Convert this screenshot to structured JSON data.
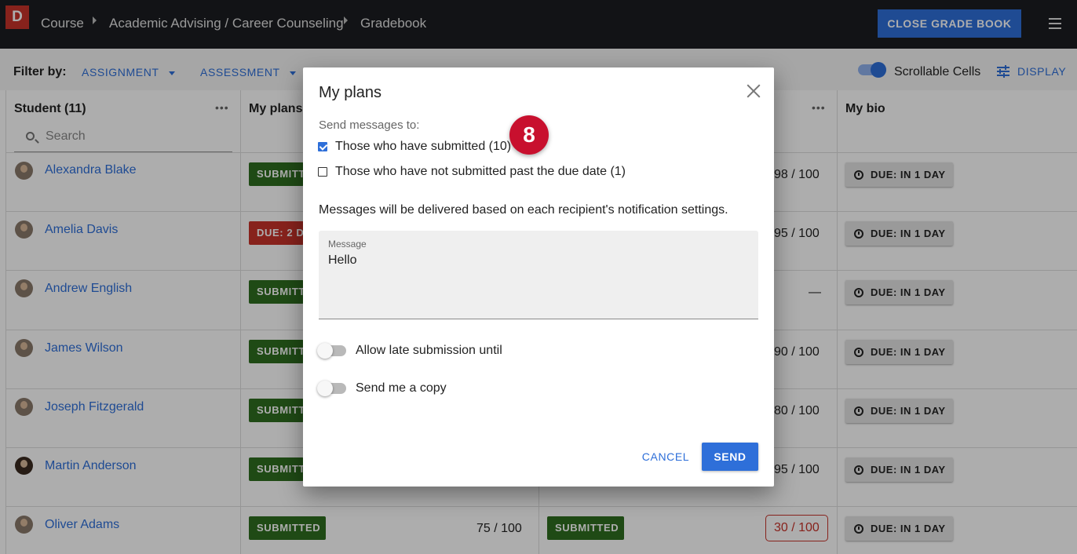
{
  "app": {
    "logo_letter": "D"
  },
  "breadcrumb": [
    "Course",
    "Academic Advising / Career Counseling",
    "Gradebook"
  ],
  "header": {
    "close_label": "CLOSE GRADE BOOK",
    "menu_icon": "hamburger-menu-icon"
  },
  "filter": {
    "label": "Filter by:",
    "assignment": "ASSIGNMENT",
    "assessment": "ASSESSMENT",
    "scrollable_label": "Scrollable Cells",
    "scrollable_on": true,
    "display_label": "DISPLAY"
  },
  "grid": {
    "student_header": "Student (11)",
    "col_plans": "My plans",
    "col_bio": "My bio",
    "search_placeholder": "Search",
    "rows": [
      {
        "name": "Alexandra Blake",
        "plans_badge": "SUBMITTED",
        "plans_status": "submitted",
        "mid_score": "98 / 100",
        "bio": "DUE: IN 1 DAY"
      },
      {
        "name": "Amelia Davis",
        "plans_badge": "DUE: 2 DAYS AGO",
        "plans_status": "late",
        "mid_score": "95 / 100",
        "bio": "DUE: IN 1 DAY"
      },
      {
        "name": "Andrew English",
        "plans_badge": "SUBMITTED",
        "plans_status": "submitted",
        "mid_score": "—",
        "bio": "DUE: IN 1 DAY"
      },
      {
        "name": "James Wilson",
        "plans_badge": "SUBMITTED",
        "plans_status": "submitted",
        "mid_score": "90 / 100",
        "bio": "DUE: IN 1 DAY"
      },
      {
        "name": "Joseph Fitzgerald",
        "plans_badge": "SUBMITTED",
        "plans_status": "submitted",
        "mid_score": "80 / 100",
        "bio": "DUE: IN 1 DAY"
      },
      {
        "name": "Martin Anderson",
        "plans_badge": "SUBMITTED",
        "plans_status": "submitted",
        "mid_score": "95 / 100",
        "bio": "DUE: IN 1 DAY"
      },
      {
        "name": "Oliver Adams",
        "plans_badge": "SUBMITTED",
        "plans_status": "submitted",
        "plans_score": "75 / 100",
        "mid_badge": "SUBMITTED",
        "mid_score": "30 / 100",
        "bio": "DUE: IN 1 DAY"
      }
    ]
  },
  "dialog": {
    "title": "My plans",
    "send_to_label": "Send messages to:",
    "option_submitted": "Those who have submitted (10)",
    "option_submitted_checked": true,
    "option_not_submitted": "Those who have not submitted past the due date (1)",
    "option_not_submitted_checked": false,
    "notice": "Messages will be delivered based on each recipient's notification settings.",
    "message_label": "Message",
    "message_value": "Hello",
    "late_label": "Allow late submission until",
    "late_on": false,
    "copy_label": "Send me a copy",
    "copy_on": false,
    "cancel_label": "CANCEL",
    "send_label": "SEND"
  },
  "step_marker": "8",
  "colors": {
    "accent": "#2e6fd9",
    "submitted": "#2f6e1f",
    "late": "#c8332a",
    "topbar": "#1b1d21"
  }
}
